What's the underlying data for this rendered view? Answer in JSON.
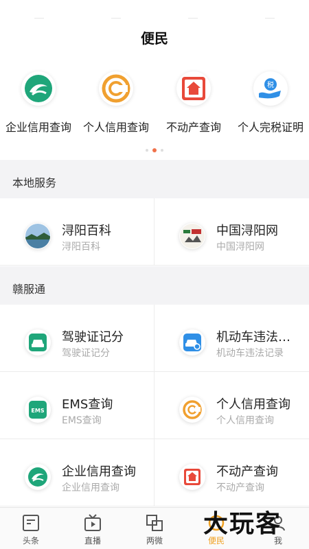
{
  "page_title": "便民",
  "quick_services": [
    {
      "label": "企业信用查询",
      "icon": "enterprise-credit-icon"
    },
    {
      "label": "个人信用查询",
      "icon": "personal-credit-icon"
    },
    {
      "label": "不动产查询",
      "icon": "real-estate-icon"
    },
    {
      "label": "个人完税证明",
      "icon": "tax-certificate-icon"
    }
  ],
  "carousel": {
    "active_page": 2,
    "pages": 3
  },
  "local_services": {
    "header": "本地服务",
    "items": [
      {
        "title": "浔阳百科",
        "subtitle": "浔阳百科",
        "icon": "xunyang-baike-icon"
      },
      {
        "title": "中国浔阳网",
        "subtitle": "中国浔阳网",
        "icon": "xunyang-net-icon"
      }
    ]
  },
  "ganfutong": {
    "header": "赣服通",
    "items": [
      {
        "title": "驾驶证记分",
        "subtitle": "驾驶证记分",
        "icon": "driver-license-icon"
      },
      {
        "title": "机动车违法记录",
        "subtitle": "机动车违法记录",
        "icon": "vehicle-violation-icon"
      },
      {
        "title": "EMS查询",
        "subtitle": "EMS查询",
        "icon": "ems-icon"
      },
      {
        "title": "个人信用查询",
        "subtitle": "个人信用查询",
        "icon": "personal-credit-icon"
      },
      {
        "title": "企业信用查询",
        "subtitle": "企业信用查询",
        "icon": "enterprise-credit-icon"
      },
      {
        "title": "不动产查询",
        "subtitle": "不动产查询",
        "icon": "real-estate-icon"
      }
    ]
  },
  "tabbar": [
    {
      "label": "头条",
      "icon": "headline-icon"
    },
    {
      "label": "直播",
      "icon": "tv-icon"
    },
    {
      "label": "两微",
      "icon": "weibo-wechat-icon"
    },
    {
      "label": "便民",
      "icon": "convenience-icon",
      "active": true
    },
    {
      "label": "我",
      "icon": "profile-icon"
    }
  ],
  "watermark": "大玩客",
  "colors": {
    "accent": "#f0a020",
    "green": "#1fa67a",
    "orange": "#f0a030",
    "red": "#e8493a",
    "blue": "#2f8fe6"
  }
}
